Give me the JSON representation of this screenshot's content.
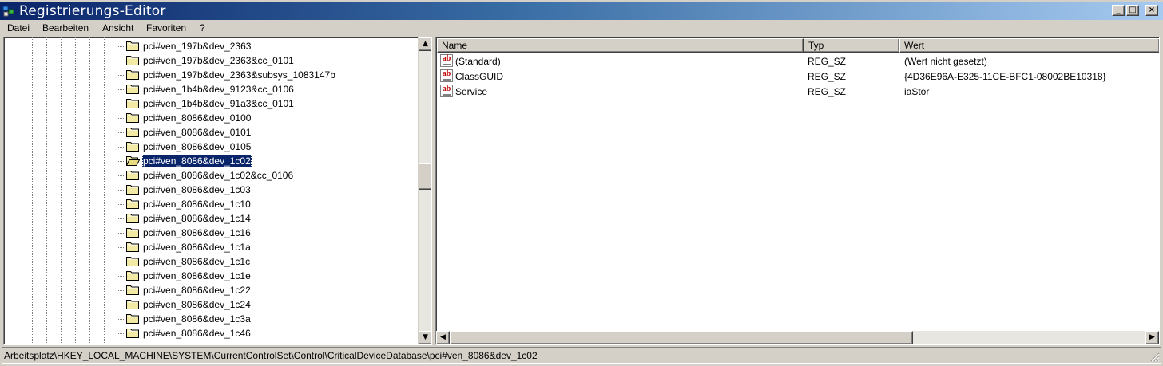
{
  "window": {
    "title": "Registrierungs-Editor",
    "app_icon": "regedit-icon",
    "caption_buttons": {
      "minimize": "_",
      "maximize": "□",
      "close": "×"
    }
  },
  "menu": [
    "Datei",
    "Bearbeiten",
    "Ansicht",
    "Favoriten",
    "?"
  ],
  "tree": {
    "items": [
      {
        "label": "pci#ven_197b&dev_2363",
        "selected": false
      },
      {
        "label": "pci#ven_197b&dev_2363&cc_0101",
        "selected": false
      },
      {
        "label": "pci#ven_197b&dev_2363&subsys_1083147b",
        "selected": false
      },
      {
        "label": "pci#ven_1b4b&dev_9123&cc_0106",
        "selected": false
      },
      {
        "label": "pci#ven_1b4b&dev_91a3&cc_0101",
        "selected": false
      },
      {
        "label": "pci#ven_8086&dev_0100",
        "selected": false
      },
      {
        "label": "pci#ven_8086&dev_0101",
        "selected": false
      },
      {
        "label": "pci#ven_8086&dev_0105",
        "selected": false
      },
      {
        "label": "pci#ven_8086&dev_1c02",
        "selected": true
      },
      {
        "label": "pci#ven_8086&dev_1c02&cc_0106",
        "selected": false
      },
      {
        "label": "pci#ven_8086&dev_1c03",
        "selected": false
      },
      {
        "label": "pci#ven_8086&dev_1c10",
        "selected": false
      },
      {
        "label": "pci#ven_8086&dev_1c14",
        "selected": false
      },
      {
        "label": "pci#ven_8086&dev_1c16",
        "selected": false
      },
      {
        "label": "pci#ven_8086&dev_1c1a",
        "selected": false
      },
      {
        "label": "pci#ven_8086&dev_1c1c",
        "selected": false
      },
      {
        "label": "pci#ven_8086&dev_1c1e",
        "selected": false
      },
      {
        "label": "pci#ven_8086&dev_1c22",
        "selected": false
      },
      {
        "label": "pci#ven_8086&dev_1c24",
        "selected": false
      },
      {
        "label": "pci#ven_8086&dev_1c3a",
        "selected": false
      },
      {
        "label": "pci#ven_8086&dev_1c46",
        "selected": false
      }
    ]
  },
  "values": {
    "columns": [
      "Name",
      "Typ",
      "Wert"
    ],
    "rows": [
      {
        "name": "(Standard)",
        "type": "REG_SZ",
        "data": "(Wert nicht gesetzt)"
      },
      {
        "name": "ClassGUID",
        "type": "REG_SZ",
        "data": "{4D36E96A-E325-11CE-BFC1-08002BE10318}"
      },
      {
        "name": "Service",
        "type": "REG_SZ",
        "data": "iaStor"
      }
    ]
  },
  "status": {
    "path": "Arbeitsplatz\\HKEY_LOCAL_MACHINE\\SYSTEM\\CurrentControlSet\\Control\\CriticalDeviceDatabase\\pci#ven_8086&dev_1c02"
  },
  "colors": {
    "titlebar_start": "#0a246a",
    "titlebar_end": "#a6caf0",
    "selection": "#0a246a",
    "face": "#d4d0c8",
    "folder": "#f1e9a4"
  }
}
